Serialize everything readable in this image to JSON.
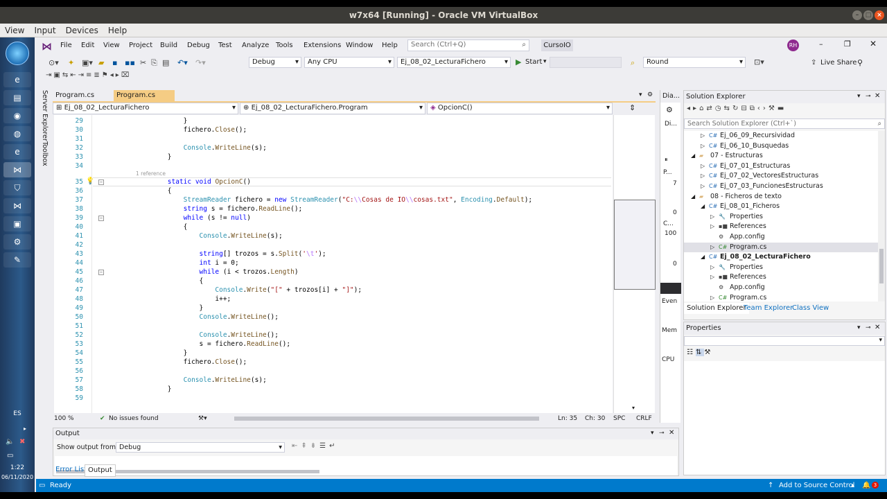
{
  "host": {
    "title": "w7x64 [Running] - Oracle VM VirtualBox",
    "menu": [
      "View",
      "Input",
      "Devices",
      "Help"
    ]
  },
  "taskbar": {
    "lang": "ES",
    "time": "1:22",
    "date": "06/11/2020"
  },
  "vs": {
    "menu": [
      "File",
      "Edit",
      "View",
      "Project",
      "Build",
      "Debug",
      "Test",
      "Analyze",
      "Tools",
      "Extensions",
      "Window",
      "Help"
    ],
    "search_placeholder": "Search (Ctrl+Q)",
    "solution_name": "CursoIO",
    "avatar": "RH",
    "config": "Debug",
    "platform": "Any CPU",
    "startup_project": "Ej_08_02_LecturaFichero",
    "start_label": "Start",
    "find_box": "Round",
    "live_share": "Live Share",
    "tabs": [
      "Program.cs",
      "Program.cs"
    ],
    "nav": [
      "Ej_08_02_LecturaFichero",
      "Ej_08_02_LecturaFichero.Program",
      "OpcionC()"
    ],
    "side_tabs": [
      "Server Explorer",
      "Toolbox"
    ],
    "code": {
      "lines": [
        {
          "n": "29",
          "t": "            }"
        },
        {
          "n": "30",
          "t": "            fichero.Close();"
        },
        {
          "n": "31",
          "t": ""
        },
        {
          "n": "32",
          "t": "            Console.WriteLine(s);"
        },
        {
          "n": "33",
          "t": "        }"
        },
        {
          "n": "34",
          "t": ""
        },
        {
          "n": "35",
          "t": "        static void OpcionC()"
        },
        {
          "n": "36",
          "t": "        {"
        },
        {
          "n": "37",
          "t": "            StreamReader fichero = new StreamReader(\"C:\\\\Cosas de IO\\\\cosas.txt\", Encoding.Default);"
        },
        {
          "n": "38",
          "t": "            string s = fichero.ReadLine();"
        },
        {
          "n": "39",
          "t": "            while (s != null)"
        },
        {
          "n": "40",
          "t": "            {"
        },
        {
          "n": "41",
          "t": "                Console.WriteLine(s);"
        },
        {
          "n": "42",
          "t": ""
        },
        {
          "n": "43",
          "t": "                string[] trozos = s.Split('\\t');"
        },
        {
          "n": "44",
          "t": "                int i = 0;"
        },
        {
          "n": "45",
          "t": "                while (i < trozos.Length)"
        },
        {
          "n": "46",
          "t": "                {"
        },
        {
          "n": "47",
          "t": "                    Console.Write(\"[\" + trozos[i] + \"]\");"
        },
        {
          "n": "48",
          "t": "                    i++;"
        },
        {
          "n": "49",
          "t": "                }"
        },
        {
          "n": "50",
          "t": "                Console.WriteLine();"
        },
        {
          "n": "51",
          "t": ""
        },
        {
          "n": "52",
          "t": "                Console.WriteLine();"
        },
        {
          "n": "53",
          "t": "                s = fichero.ReadLine();"
        },
        {
          "n": "54",
          "t": "            }"
        },
        {
          "n": "55",
          "t": "            fichero.Close();"
        },
        {
          "n": "56",
          "t": ""
        },
        {
          "n": "57",
          "t": "            Console.WriteLine(s);"
        },
        {
          "n": "58",
          "t": "        }"
        },
        {
          "n": "59",
          "t": ""
        }
      ],
      "reference_hint": "1 reference"
    },
    "editor_status": {
      "zoom": "100 %",
      "issues": "No issues found",
      "ln": "Ln: 35",
      "ch": "Ch: 30",
      "spc": "SPC",
      "crlf": "CRLF"
    },
    "diag": {
      "title": "Dia...",
      "items": [
        "Di...",
        "⏸",
        "P...",
        "7",
        "0",
        "C...",
        "100",
        "0",
        "Even",
        "Mem",
        "CPU"
      ]
    },
    "solution_explorer": {
      "title": "Solution Explorer",
      "search_placeholder": "Search Solution Explorer (Ctrl+`)",
      "items": [
        {
          "l": "Ej_06_09_Recursividad",
          "d": 2,
          "ic": "C#"
        },
        {
          "l": "Ej_06_10_Busquedas",
          "d": 2,
          "ic": "C#"
        },
        {
          "l": "07 - Estructuras",
          "d": 1,
          "ic": "folder"
        },
        {
          "l": "Ej_07_01_Estructuras",
          "d": 2,
          "ic": "C#"
        },
        {
          "l": "Ej_07_02_VectoresEstructuras",
          "d": 2,
          "ic": "C#"
        },
        {
          "l": "Ej_07_03_FuncionesEstructuras",
          "d": 2,
          "ic": "C#"
        },
        {
          "l": "08 - Ficheros de texto",
          "d": 1,
          "ic": "folder"
        },
        {
          "l": "Ej_08_01_Ficheros",
          "d": 2,
          "ic": "C#"
        },
        {
          "l": "Properties",
          "d": 3,
          "ic": "wrench"
        },
        {
          "l": "References",
          "d": 3,
          "ic": "ref"
        },
        {
          "l": "App.config",
          "d": 3,
          "ic": "cfg"
        },
        {
          "l": "Program.cs",
          "d": 3,
          "ic": "cs"
        },
        {
          "l": "Ej_08_02_LecturaFichero",
          "d": 2,
          "ic": "C#"
        },
        {
          "l": "Properties",
          "d": 3,
          "ic": "wrench"
        },
        {
          "l": "References",
          "d": 3,
          "ic": "ref"
        },
        {
          "l": "App.config",
          "d": 3,
          "ic": "cfg"
        },
        {
          "l": "Program.cs",
          "d": 3,
          "ic": "cs"
        }
      ],
      "tabs": [
        "Solution Explorer",
        "Team Explorer",
        "Class View"
      ]
    },
    "properties": {
      "title": "Properties"
    },
    "output": {
      "title": "Output",
      "show_from_label": "Show output from:",
      "show_from_value": "Debug",
      "tabs": [
        "Error List",
        "Output"
      ]
    },
    "status": {
      "ready": "Ready",
      "source_control": "Add to Source Control",
      "notifications": "3"
    }
  },
  "colors": {
    "accent": "#007acc",
    "vs_bg": "#eeeef2",
    "active_tab": "#f5cc84",
    "keyword": "#0000ff",
    "type": "#2b91af",
    "string": "#a31515"
  }
}
